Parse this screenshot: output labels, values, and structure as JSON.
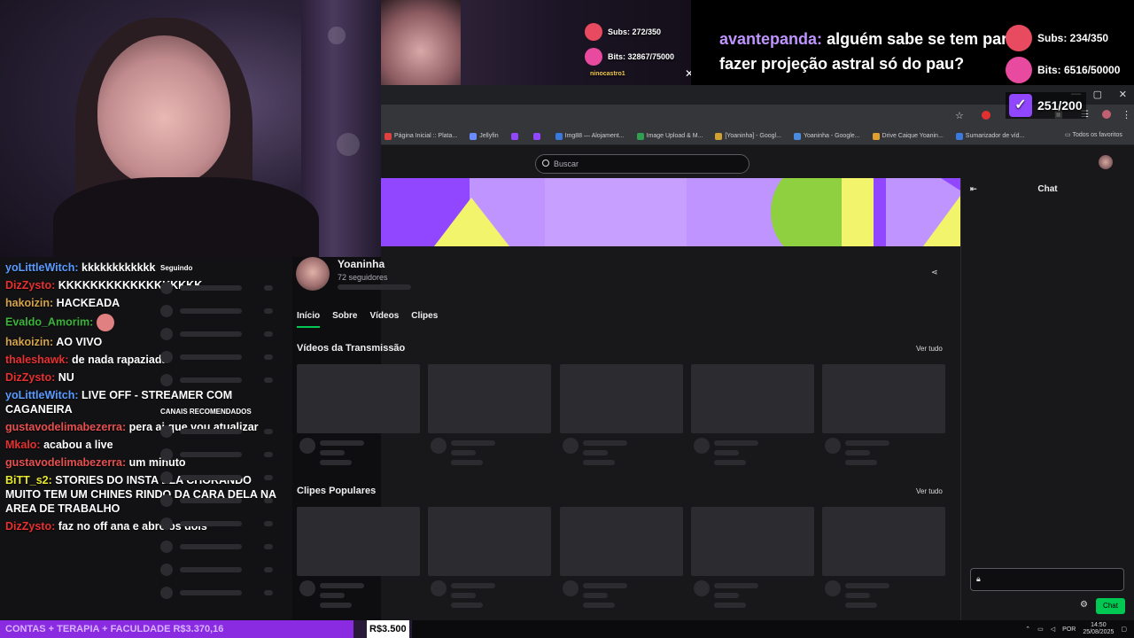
{
  "overlay": {
    "subs_small": "Subs: 272/350",
    "bits_small": "Bits: 32867/75000",
    "mini_user": "ninocastro1",
    "subs_large": "Subs: 234/350",
    "bits_large": "Bits: 6516/50000",
    "badge_count": "251/200",
    "top_chat_user": "avantepanda:",
    "top_chat_msg": "alguém sabe se tem para",
    "top_chat_msg2": "fazer projeção astral só do pau?"
  },
  "chat": [
    {
      "user": "yoLittleWitch:",
      "color": "#5a9bff",
      "msg": "kkkkkkkkkkkk"
    },
    {
      "user": "DizZysto:",
      "color": "#e83030",
      "msg": "KKKKKKKKKKKKKKKKKK"
    },
    {
      "user": "hakoizin:",
      "color": "#d4a34a",
      "msg": "HACKEADA"
    },
    {
      "user": "Evaldo_Amorim:",
      "color": "#3cb43c",
      "msg": ""
    },
    {
      "user": "hakoizin:",
      "color": "#d4a34a",
      "msg": "AO VIVO"
    },
    {
      "user": "thaleshawk:",
      "color": "#e83030",
      "msg": "de nada rapaziada"
    },
    {
      "user": "DizZysto:",
      "color": "#e83030",
      "msg": "NU"
    },
    {
      "user": "yoLittleWitch:",
      "color": "#5a9bff",
      "msg": "LIVE OFF - STREAMER COM CAGANEIRA"
    },
    {
      "user": "gustavodelimabezerra:",
      "color": "#e85050",
      "msg": "pera ai que vou atualizar"
    },
    {
      "user": "Mkalo:",
      "color": "#e83030",
      "msg": "acabou a live"
    },
    {
      "user": "gustavodelimabezerra:",
      "color": "#e85050",
      "msg": "um minuto"
    },
    {
      "user": "BiTT_s2:",
      "color": "#e8e830",
      "msg": "STORIES DO INSTA ELA CHORANDO MUITO TEM UM CHINES RINDO DA CARA DELA NA AREA DE TRABALHO"
    },
    {
      "user": "DizZysto:",
      "color": "#e83030",
      "msg": "faz no off ana e abre os dois"
    }
  ],
  "browser": {
    "bookmarks": [
      "Página Inicial :: Plata...",
      "Jellyfin",
      "",
      "",
      "Img88 — Alojament...",
      "Image Upload & M...",
      "[Yoaninha] - Googl...",
      "Yoaninha - Google...",
      "Drive Caique Yoanin...",
      "Sumarizador de víd..."
    ],
    "all_favorites": "Todos os favoritos",
    "search_placeholder": "Buscar"
  },
  "sidebar": {
    "following": "Seguindo",
    "recommended": "CANAIS RECOMENDADOS"
  },
  "channel": {
    "name": "Yoaninha",
    "followers": "72 seguidores",
    "tabs": [
      "Início",
      "Sobre",
      "Vídeos",
      "Clipes"
    ],
    "section1": "Vídeos da Transmissão",
    "section2": "Clipes Populares",
    "see_all": "Ver tudo"
  },
  "chat_panel": {
    "title": "Chat",
    "chat_button": "Chat"
  },
  "bottom": {
    "goal_text": "CONTAS + TERAPIA + FACULDADE",
    "goal_value": "R$3.370,16",
    "goal_amount": "R$3.500",
    "goal_progress": 0.963,
    "lang": "POR",
    "time": "14:50",
    "date": "25/08/2025"
  },
  "colors": {
    "accent": "#00c853",
    "banner_purple": "#bf94ff",
    "banner_yellow": "#f2f56b",
    "banner_violet": "#9147ff"
  }
}
